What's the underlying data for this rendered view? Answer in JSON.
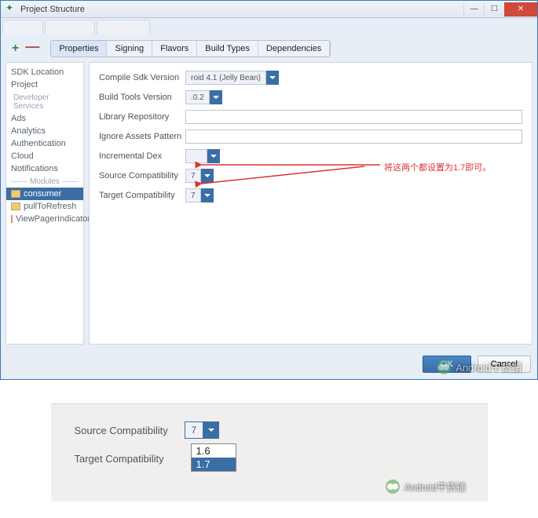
{
  "window": {
    "title": "Project Structure",
    "bg_tabs": [
      "",
      "",
      ""
    ]
  },
  "toolbar": {
    "add": "+",
    "remove": "—"
  },
  "tabs": [
    "Properties",
    "Signing",
    "Flavors",
    "Build Types",
    "Dependencies"
  ],
  "active_tab": 0,
  "left": {
    "items_top": [
      "SDK Location",
      "Project"
    ],
    "section_dev": "Developer Services",
    "items_dev": [
      "Ads",
      "Analytics",
      "Authentication",
      "Cloud",
      "Notifications"
    ],
    "section_mod": "Modules",
    "modules": [
      "consumer",
      "pullToRefresh",
      "ViewPagerIndicator"
    ],
    "selected_module": 0
  },
  "form": {
    "compile_sdk_label": "Compile Sdk Version",
    "compile_sdk_value": "roid 4.1 (Jelly Bean)",
    "build_tools_label": "Build Tools Version",
    "build_tools_value": ".0.2",
    "library_repo_label": "Library Repository",
    "library_repo_value": "",
    "ignore_assets_label": "Ignore Assets Pattern",
    "ignore_assets_value": "",
    "incremental_dex_label": "Incremental Dex",
    "incremental_dex_value": "",
    "source_compat_label": "Source Compatibility",
    "source_compat_value": "7",
    "target_compat_label": "Target Compatibility",
    "target_compat_value": "7"
  },
  "annotation": "将这两个都设置为1.7即可。",
  "buttons": {
    "ok": "OK",
    "cancel": "Cancel"
  },
  "watermark": "Android干货铺",
  "lower": {
    "source_label": "Source Compatibility",
    "source_value": "7",
    "target_label": "Target Compatibility",
    "options": [
      "1.6",
      "1.7"
    ],
    "selected_option": 1,
    "watermark": "Android干货铺"
  }
}
